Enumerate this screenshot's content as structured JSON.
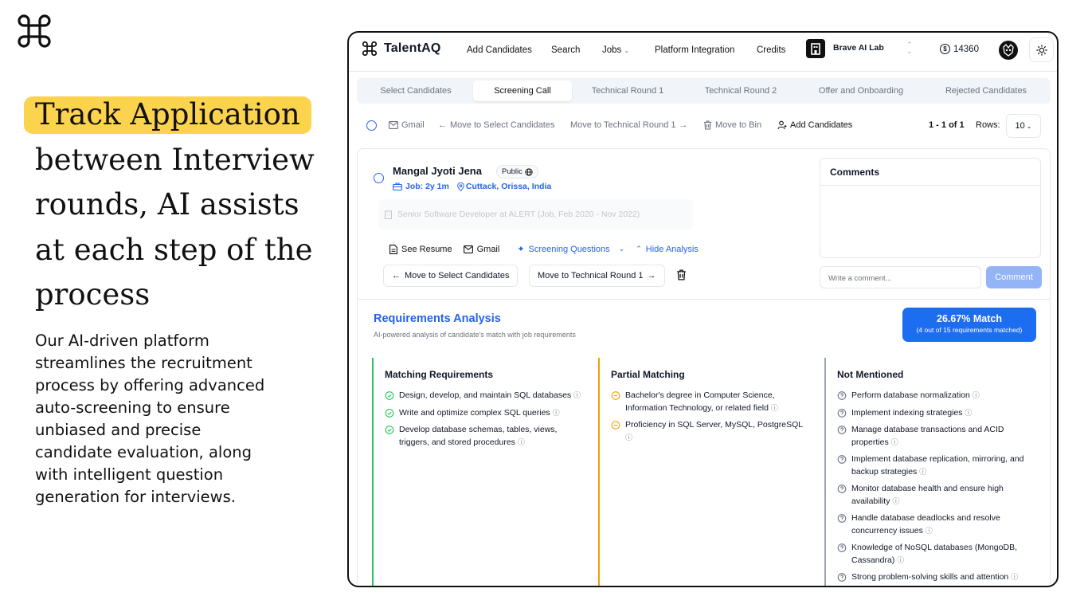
{
  "hero": {
    "highlight": "Track Application",
    "rest": "between Interview rounds, AI assists at each step of the process",
    "description": "Our AI-driven platform streamlines the recruitment process by offering advanced auto-screening to ensure unbiased and precise candidate evaluation, along with intelligent question generation for interviews."
  },
  "app": {
    "brand": "TalentAQ",
    "nav": [
      "Add Candidates",
      "Search",
      "Jobs",
      "Platform Integration",
      "Credits"
    ],
    "org_name": "Brave AI Lab",
    "credits": "14360"
  },
  "tabs": [
    "Select Candidates",
    "Screening Call",
    "Technical Round 1",
    "Technical Round 2",
    "Offer and Onboarding",
    "Rejected Candidates"
  ],
  "active_tab": "Screening Call",
  "toolbar": {
    "gmail": "Gmail",
    "move_select": "Move to Select Candidates",
    "move_tech": "Move to Technical Round 1",
    "move_bin": "Move to Bin",
    "add_candidates": "Add Candidates",
    "pagination": "1 - 1 of 1",
    "rows_label": "Rows:",
    "rows_value": "10"
  },
  "candidate": {
    "name": "Mangal Jyoti Jena",
    "visibility": "Public",
    "job": "Job: 2y 1m",
    "location": "Cuttack, Orissa, India",
    "experience": "Senior Software Developer at ALERT (Job, Feb 2020 - Nov 2022)",
    "see_resume": "See Resume",
    "gmail": "Gmail",
    "screening_questions": "Screening Questions",
    "hide_analysis": "Hide Analysis",
    "move_select": "Move to Select Candidates",
    "move_tech": "Move to Technical Round 1"
  },
  "comments": {
    "title": "Comments",
    "placeholder": "Write a comment...",
    "button": "Comment"
  },
  "analysis": {
    "title": "Requirements Analysis",
    "subtitle": "AI-powered analysis of candidate's match with job requirements",
    "match": "26.67% Match",
    "match_detail": "(4 out of 15 requirements matched)",
    "matching_head": "Matching Requirements",
    "matching": [
      "Design, develop, and maintain SQL databases",
      "Write and optimize complex SQL queries",
      "Develop database schemas, tables, views, triggers, and stored procedures"
    ],
    "partial_head": "Partial Matching",
    "partial": [
      "Bachelor's degree in Computer Science, Information Technology, or related field",
      "Proficiency in SQL Server, MySQL, PostgreSQL"
    ],
    "missing_head": "Not Mentioned",
    "missing": [
      "Perform database normalization",
      "Implement indexing strategies",
      "Manage database transactions and ACID properties",
      "Implement database replication, mirroring, and backup strategies",
      "Monitor database health and ensure high availability",
      "Handle database deadlocks and resolve concurrency issues",
      "Knowledge of NoSQL databases (MongoDB, Cassandra)",
      "Strong problem-solving skills and attention"
    ]
  },
  "colors": {
    "highlight": "#fcd34d",
    "accent": "#2563eb",
    "match_bg": "#1d6df0",
    "green": "#22c55e",
    "amber": "#f59e0b",
    "grey": "#6b7280"
  }
}
